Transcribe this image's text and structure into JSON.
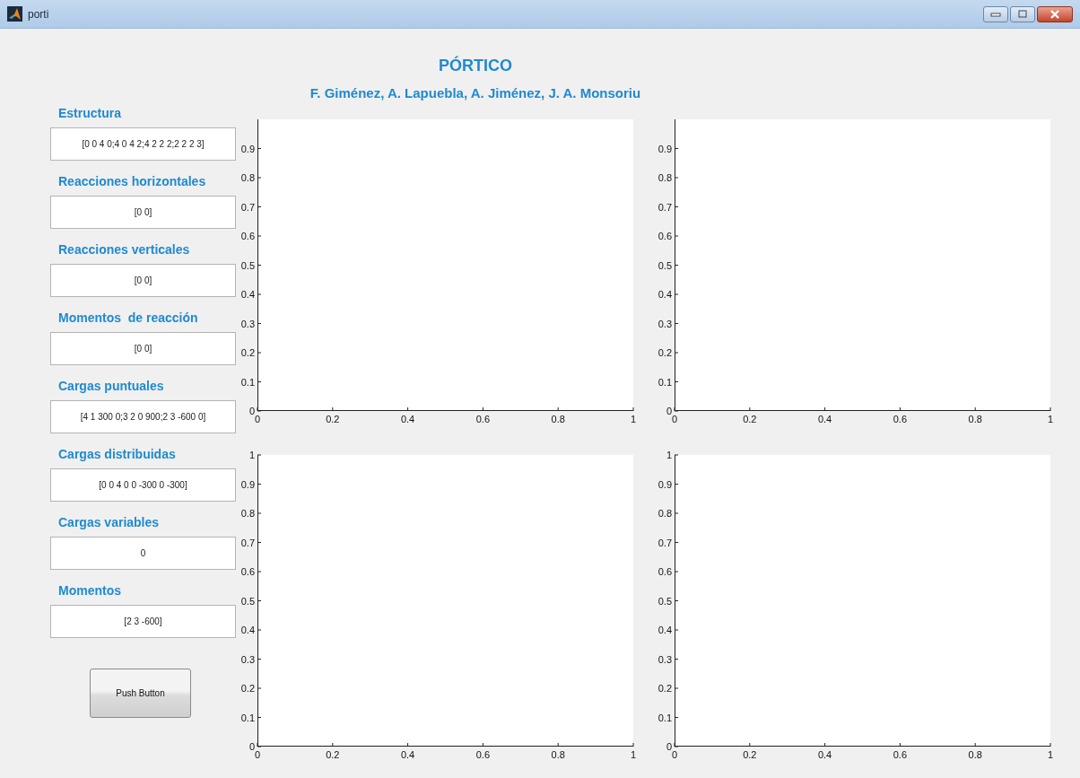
{
  "window": {
    "title": "porti"
  },
  "header": {
    "title": "PÓRTICO",
    "authors": "F. Giménez, A. Lapuebla, A. Jiménez, J. A. Monsoriu"
  },
  "fields": [
    {
      "label": "Estructura",
      "value": "[0 0 4 0;4 0 4 2;4 2 2 2;2 2 2 3]"
    },
    {
      "label": "Reacciones horizontales",
      "value": "[0 0]"
    },
    {
      "label": "Reacciones verticales",
      "value": "[0 0]"
    },
    {
      "label": "Momentos  de reacción",
      "value": "[0 0]"
    },
    {
      "label": "Cargas puntuales",
      "value": "[4 1 300 0;3 2 0 900;2 3 -600 0]"
    },
    {
      "label": "Cargas distribuidas",
      "value": "[0 0 4 0 0 -300 0 -300]"
    },
    {
      "label": "Cargas variables",
      "value": "0"
    },
    {
      "label": "Momentos",
      "value": "[2 3 -600]"
    }
  ],
  "button": {
    "label": "Push Button"
  },
  "axes": [
    {
      "chart_data": {
        "type": "line",
        "xlim": [
          0,
          1
        ],
        "ylim": [
          0,
          1
        ],
        "xticks": [
          0,
          0.2,
          0.4,
          0.6,
          0.8,
          1
        ],
        "yticks": [
          0,
          0.1,
          0.2,
          0.3,
          0.4,
          0.5,
          0.6,
          0.7,
          0.8,
          0.9
        ]
      }
    },
    {
      "chart_data": {
        "type": "line",
        "xlim": [
          0,
          1
        ],
        "ylim": [
          0,
          1
        ],
        "xticks": [
          0,
          0.2,
          0.4,
          0.6,
          0.8,
          1
        ],
        "yticks": [
          0,
          0.1,
          0.2,
          0.3,
          0.4,
          0.5,
          0.6,
          0.7,
          0.8,
          0.9
        ]
      }
    },
    {
      "chart_data": {
        "type": "line",
        "xlim": [
          0,
          1
        ],
        "ylim": [
          0,
          1
        ],
        "xticks": [
          0,
          0.2,
          0.4,
          0.6,
          0.8,
          1
        ],
        "yticks": [
          0,
          0.1,
          0.2,
          0.3,
          0.4,
          0.5,
          0.6,
          0.7,
          0.8,
          0.9,
          1
        ]
      }
    },
    {
      "chart_data": {
        "type": "line",
        "xlim": [
          0,
          1
        ],
        "ylim": [
          0,
          1
        ],
        "xticks": [
          0,
          0.2,
          0.4,
          0.6,
          0.8,
          1
        ],
        "yticks": [
          0,
          0.1,
          0.2,
          0.3,
          0.4,
          0.5,
          0.6,
          0.7,
          0.8,
          0.9,
          1
        ]
      }
    }
  ]
}
